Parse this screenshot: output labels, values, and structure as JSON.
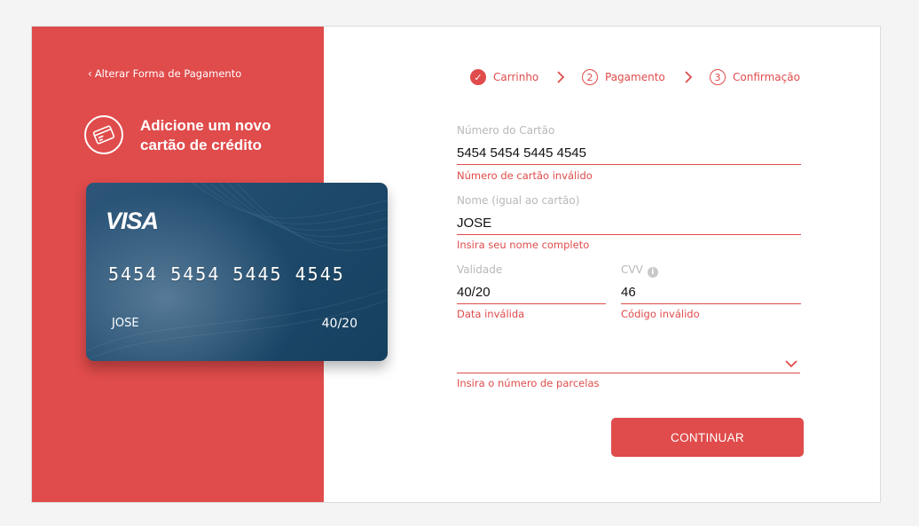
{
  "left_panel": {
    "back_link": "Alterar Forma de Pagamento",
    "title_line1": "Adicione um novo",
    "title_line2": "cartão de crédito",
    "card_icon": "credit-card-icon"
  },
  "card": {
    "brand": "VISA",
    "number": "5454 5454 5445 4545",
    "holder": "JOSE",
    "expiry": "40/20"
  },
  "steps": [
    {
      "marker": "✓",
      "label": "Carrinho",
      "status": "done"
    },
    {
      "marker": "2",
      "label": "Pagamento",
      "status": "pending"
    },
    {
      "marker": "3",
      "label": "Confirmação",
      "status": "pending"
    }
  ],
  "form": {
    "card_number": {
      "label": "Número do Cartão",
      "value": "5454 5454 5445 4545",
      "error": "Número de cartão inválido"
    },
    "name": {
      "label": "Nome (igual ao cartão)",
      "value": "JOSE",
      "error": "Insira seu nome completo"
    },
    "expiry": {
      "label": "Validade",
      "value": "40/20",
      "error": "Data inválida"
    },
    "cvv": {
      "label": "CVV",
      "value": "46",
      "error": "Código inválido"
    },
    "installments": {
      "value": "",
      "error": "Insira o número de parcelas"
    }
  },
  "button": {
    "label": "CONTINUAR"
  },
  "colors": {
    "accent": "#e04b4b",
    "card_blue": "#1f4a6c",
    "label_gray": "#b8b8b8"
  }
}
